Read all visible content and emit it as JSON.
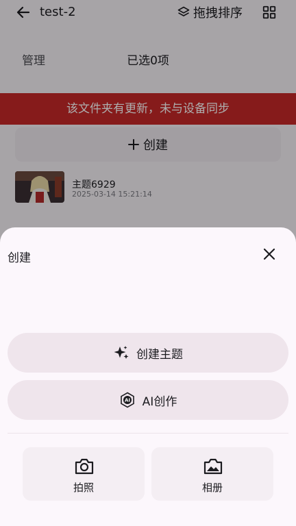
{
  "header": {
    "title": "test-2",
    "sort_label": "拖拽排序",
    "icons": [
      "back-arrow-icon",
      "layers-icon",
      "grid-view-icon"
    ]
  },
  "toolbar": {
    "manage_label": "管理",
    "selection_text": "已选0项"
  },
  "banner": {
    "text": "该文件夹有更新，未与设备同步",
    "color": "#c62828"
  },
  "create_row": {
    "label": "创建"
  },
  "files": [
    {
      "name": "主题6929",
      "date": "2025-03-14 15:21:14"
    }
  ],
  "sheet": {
    "title": "创建",
    "options": [
      {
        "label": "创建主题",
        "icon": "sparkle-stars-icon"
      },
      {
        "label": "AI创作",
        "icon": "ai-badge-icon"
      }
    ],
    "sources": [
      {
        "label": "拍照",
        "icon": "camera-icon"
      },
      {
        "label": "相册",
        "icon": "gallery-icon"
      }
    ]
  }
}
